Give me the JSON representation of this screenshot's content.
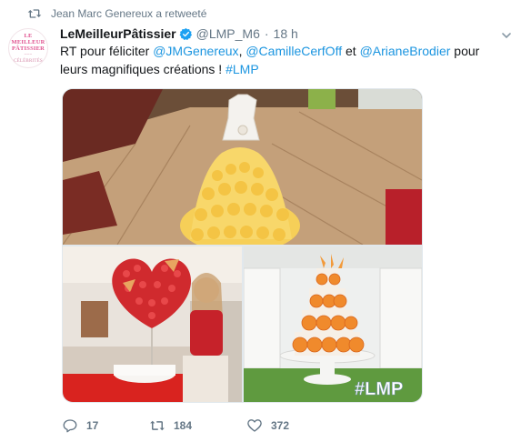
{
  "retweet_context": {
    "icon": "retweet-icon",
    "text": "Jean Marc Genereux a retweeté"
  },
  "author": {
    "avatar_lines": [
      "LE MEILLEUR",
      "PÂTISSIER",
      "~~~",
      "CÉLÉBRITÉS"
    ],
    "display_name": "LeMeilleurPâtissier",
    "verified": true,
    "handle": "@LMP_M6",
    "separator": "·",
    "time": "18 h"
  },
  "tweet": {
    "parts": [
      {
        "type": "text",
        "value": "RT pour féliciter "
      },
      {
        "type": "mention",
        "value": "@JMGenereux"
      },
      {
        "type": "text",
        "value": ", "
      },
      {
        "type": "mention",
        "value": "@CamilleCerfOff"
      },
      {
        "type": "text",
        "value": " et "
      },
      {
        "type": "mention",
        "value": "@ArianeBrodier"
      },
      {
        "type": "text",
        "value": " pour leurs magnifiques créations ! "
      },
      {
        "type": "hashtag",
        "value": "#LMP"
      }
    ]
  },
  "media": {
    "top": {
      "description_icon": "photo-dress-cake"
    },
    "bottom_left": {
      "description_icon": "photo-strawberry-heart"
    },
    "bottom_right": {
      "description_icon": "photo-apricot-tower",
      "overlay_text": "#LMP"
    }
  },
  "actions": {
    "reply": {
      "icon": "reply-icon",
      "count": "17"
    },
    "retweet": {
      "icon": "retweet-icon",
      "count": "184"
    },
    "like": {
      "icon": "heart-icon",
      "count": "372"
    }
  },
  "colors": {
    "link": "#1b95e0",
    "muted": "#657786",
    "text": "#14171a",
    "verified": "#1da1f2",
    "retweet_green": "#17bf63"
  }
}
